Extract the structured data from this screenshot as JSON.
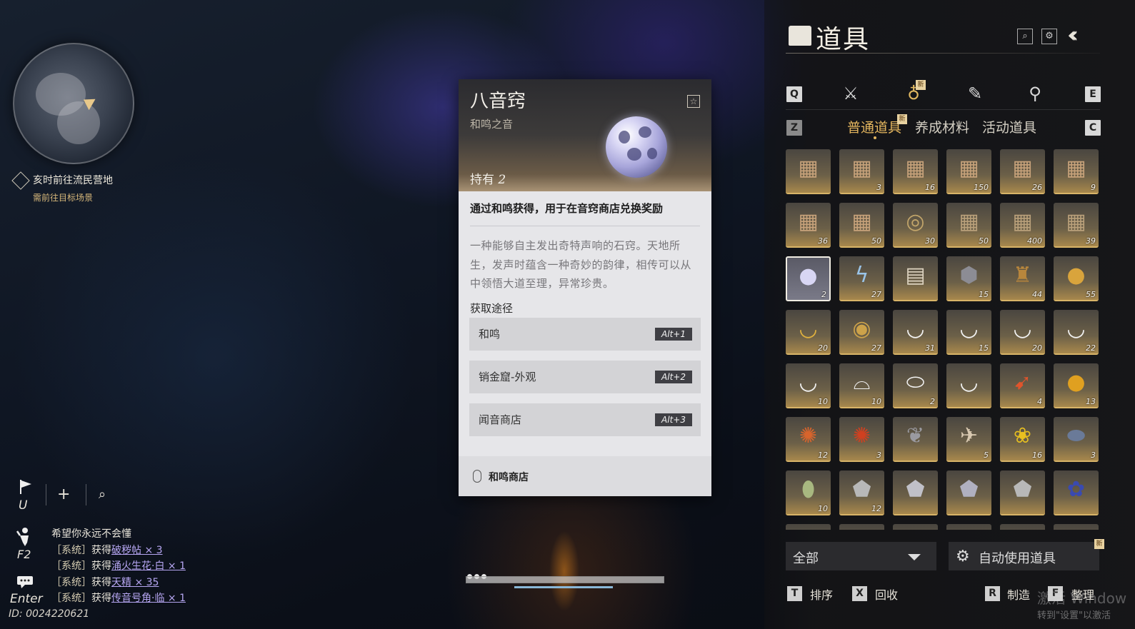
{
  "hud": {
    "quest_title": "亥时前往流民营地",
    "quest_subtitle": "需前往目标场景",
    "flag_key": "U",
    "emote_key": "F2",
    "chat_key": "Enter",
    "chat": {
      "line0": "希望你永远不会懂",
      "prefix": "获得",
      "sys_tag": "［系统］",
      "line1_item": "破秽帖 × 3",
      "line2_item": "涌火生花·白 × 1",
      "line3_item": "天精 × 35",
      "line4_item": "传音号角·临 × 1"
    },
    "player_id": "ID: 0024220621"
  },
  "tooltip": {
    "title": "八音窍",
    "subtitle": "和鸣之音",
    "owned_label": "持有",
    "owned_count": "2",
    "usage": "通过和鸣获得，用于在音窍商店兑换奖励",
    "description": "一种能够自主发出奇特声响的石窍。天地所生，发声时蕴含一种奇妙的韵律，相传可以从中领悟大道至理，异常珍贵。",
    "sources_title": "获取途径",
    "sources": [
      {
        "label": "和鸣",
        "key": "Alt+1"
      },
      {
        "label": "销金窟-外观",
        "key": "Alt+2"
      },
      {
        "label": "闻音商店",
        "key": "Alt+3"
      }
    ],
    "footer_label": "和鸣商店"
  },
  "inventory": {
    "title": "道具",
    "keys": {
      "prev_cat": "Q",
      "next_cat": "E",
      "prev_tab": "Z",
      "next_tab": "C"
    },
    "new_badge": "新",
    "subtabs": [
      "普通道具",
      "养成材料",
      "活动道具"
    ],
    "items": [
      {
        "icon": "chest-icon",
        "glyph": "▦",
        "count": "",
        "color": "#c7a27a"
      },
      {
        "icon": "chest-icon",
        "glyph": "▦",
        "count": "3",
        "color": "#c7a27a"
      },
      {
        "icon": "chest-icon",
        "glyph": "▦",
        "count": "16",
        "color": "#c7a27a"
      },
      {
        "icon": "chest-icon",
        "glyph": "▦",
        "count": "150",
        "color": "#c7a27a"
      },
      {
        "icon": "chest-heart-icon",
        "glyph": "▦",
        "count": "26",
        "color": "#c7a27a"
      },
      {
        "icon": "chest-heart-icon",
        "glyph": "▦",
        "count": "9",
        "color": "#c7a27a"
      },
      {
        "icon": "chest-icon",
        "glyph": "▦",
        "count": "36",
        "color": "#c7a27a"
      },
      {
        "icon": "chest-icon",
        "glyph": "▦",
        "count": "50",
        "color": "#c7a27a"
      },
      {
        "icon": "shell-chest-icon",
        "glyph": "◎",
        "count": "30",
        "color": "#c2a56a"
      },
      {
        "icon": "chest-icon",
        "glyph": "▦",
        "count": "50",
        "color": "#b9a07a"
      },
      {
        "icon": "chest-icon",
        "glyph": "▦",
        "count": "400",
        "color": "#b9a07a"
      },
      {
        "icon": "chest-icon",
        "glyph": "▦",
        "count": "39",
        "color": "#b9a07a"
      },
      {
        "icon": "orb-icon",
        "glyph": "●",
        "count": "2",
        "color": "#d8d6f4"
      },
      {
        "icon": "lightning-icon",
        "glyph": "ϟ",
        "count": "27",
        "color": "#9ac4e8"
      },
      {
        "icon": "book-icon",
        "glyph": "▤",
        "count": "",
        "color": "#ddd3c0"
      },
      {
        "icon": "token-icon",
        "glyph": "⬢",
        "count": "15",
        "color": "#8c8c94"
      },
      {
        "icon": "bell-icon",
        "glyph": "♜",
        "count": "44",
        "color": "#b8863c"
      },
      {
        "icon": "gold-ring-icon",
        "glyph": "●",
        "count": "55",
        "color": "#d9a43c"
      },
      {
        "icon": "gold-ingot-icon",
        "glyph": "◡",
        "count": "20",
        "color": "#e0b13e"
      },
      {
        "icon": "coin-icon",
        "glyph": "◉",
        "count": "27",
        "color": "#cca24a"
      },
      {
        "icon": "bowl-icon",
        "glyph": "◡",
        "count": "31",
        "color": "#f2f2f2"
      },
      {
        "icon": "bowl-icon",
        "glyph": "◡",
        "count": "15",
        "color": "#f2f2f2"
      },
      {
        "icon": "bowl-icon",
        "glyph": "◡",
        "count": "20",
        "color": "#f2f2f2"
      },
      {
        "icon": "bowl-icon",
        "glyph": "◡",
        "count": "22",
        "color": "#f2f2f2"
      },
      {
        "icon": "bowl-icon",
        "glyph": "◡",
        "count": "10",
        "color": "#f2f2f2"
      },
      {
        "icon": "lidded-bowl-icon",
        "glyph": "⌓",
        "count": "10",
        "color": "#f2f2f2"
      },
      {
        "icon": "plate-icon",
        "glyph": "⬭",
        "count": "2",
        "color": "#f2f2f2"
      },
      {
        "icon": "bowl-icon",
        "glyph": "◡",
        "count": "",
        "color": "#f2f2f2"
      },
      {
        "icon": "fish-icon",
        "glyph": "➹",
        "count": "4",
        "color": "#e0542c"
      },
      {
        "icon": "fruit-icon",
        "glyph": "●",
        "count": "13",
        "color": "#e0a020"
      },
      {
        "icon": "shrimp-icon",
        "glyph": "✺",
        "count": "12",
        "color": "#d8642c"
      },
      {
        "icon": "crayfish-icon",
        "glyph": "✺",
        "count": "3",
        "color": "#d04020"
      },
      {
        "icon": "creature-icon",
        "glyph": "❦",
        "count": "",
        "color": "#9a9aa0"
      },
      {
        "icon": "bird-icon",
        "glyph": "✈",
        "count": "5",
        "color": "#d8c8b0"
      },
      {
        "icon": "flower-icon",
        "glyph": "❀",
        "count": "16",
        "color": "#e8c020"
      },
      {
        "icon": "beetle-icon",
        "glyph": "⬬",
        "count": "3",
        "color": "#6a7a98"
      },
      {
        "icon": "bug-icon",
        "glyph": "⬮",
        "count": "10",
        "color": "#a8b880"
      },
      {
        "icon": "stone-icon",
        "glyph": "⬟",
        "count": "12",
        "color": "#b8b8b8"
      },
      {
        "icon": "stone-icon",
        "glyph": "⬟",
        "count": "",
        "color": "#c0c0c8"
      },
      {
        "icon": "stone-icon",
        "glyph": "⬟",
        "count": "",
        "color": "#b0b0c0"
      },
      {
        "icon": "stone-icon",
        "glyph": "⬟",
        "count": "",
        "color": "#b8b8b8"
      },
      {
        "icon": "blue-flower-icon",
        "glyph": "✿",
        "count": "",
        "color": "#3a4ab0"
      }
    ],
    "filter": "全部",
    "auto_use": "自动使用道具",
    "actions": [
      {
        "key": "T",
        "label": "排序"
      },
      {
        "key": "X",
        "label": "回收"
      },
      {
        "key": "R",
        "label": "制造"
      },
      {
        "key": "F",
        "label": "整理"
      }
    ]
  },
  "watermark": {
    "line1": "激活 Window",
    "line2": "转到\"设置\"以激活"
  }
}
